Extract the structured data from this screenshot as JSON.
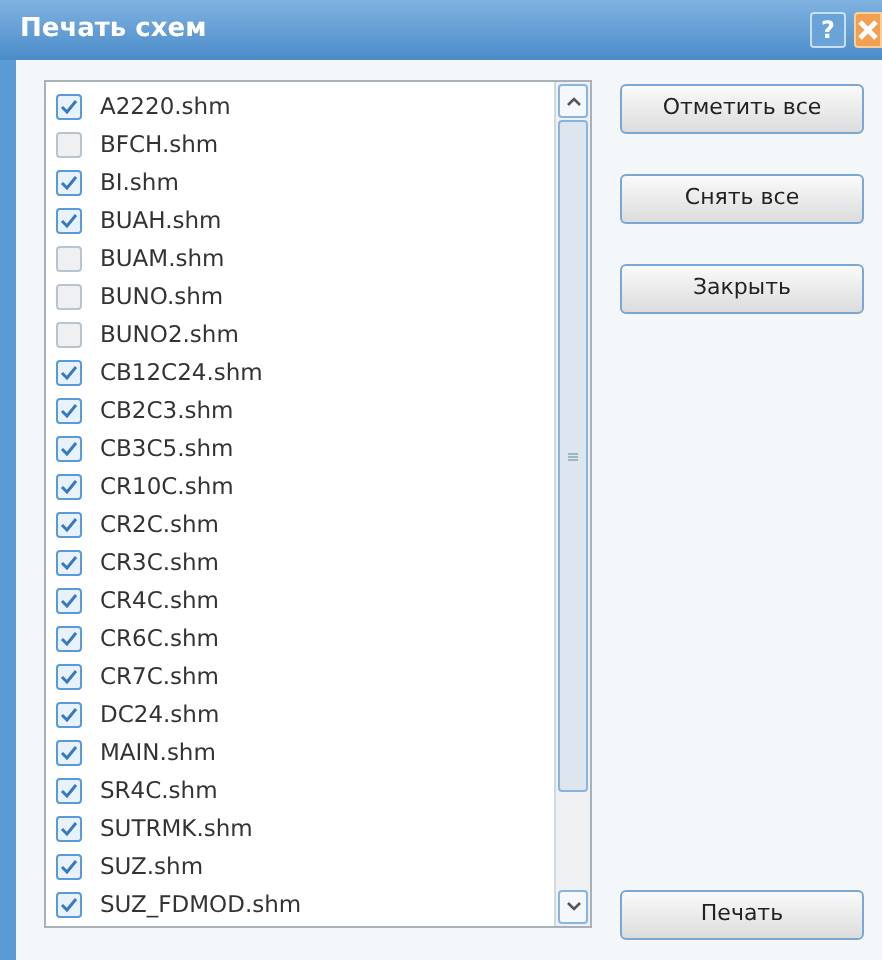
{
  "window": {
    "title": "Печать схем",
    "help": "?"
  },
  "files": [
    {
      "name": "A2220.shm",
      "checked": true
    },
    {
      "name": "BFCH.shm",
      "checked": false
    },
    {
      "name": "BI.shm",
      "checked": true
    },
    {
      "name": "BUAH.shm",
      "checked": true
    },
    {
      "name": "BUAM.shm",
      "checked": false
    },
    {
      "name": "BUNO.shm",
      "checked": false
    },
    {
      "name": "BUNO2.shm",
      "checked": false
    },
    {
      "name": "CB12C24.shm",
      "checked": true
    },
    {
      "name": "CB2C3.shm",
      "checked": true
    },
    {
      "name": "CB3C5.shm",
      "checked": true
    },
    {
      "name": "CR10C.shm",
      "checked": true
    },
    {
      "name": "CR2C.shm",
      "checked": true
    },
    {
      "name": "CR3C.shm",
      "checked": true
    },
    {
      "name": "CR4C.shm",
      "checked": true
    },
    {
      "name": "CR6C.shm",
      "checked": true
    },
    {
      "name": "CR7C.shm",
      "checked": true
    },
    {
      "name": "DC24.shm",
      "checked": true
    },
    {
      "name": "MAIN.shm",
      "checked": true
    },
    {
      "name": "SR4C.shm",
      "checked": true
    },
    {
      "name": "SUTRMK.shm",
      "checked": true
    },
    {
      "name": "SUZ.shm",
      "checked": true
    },
    {
      "name": "SUZ_FDMOD.shm",
      "checked": true
    }
  ],
  "buttons": [
    "Отметить все",
    "Снять все",
    "Закрыть"
  ],
  "print_button": "Печать"
}
